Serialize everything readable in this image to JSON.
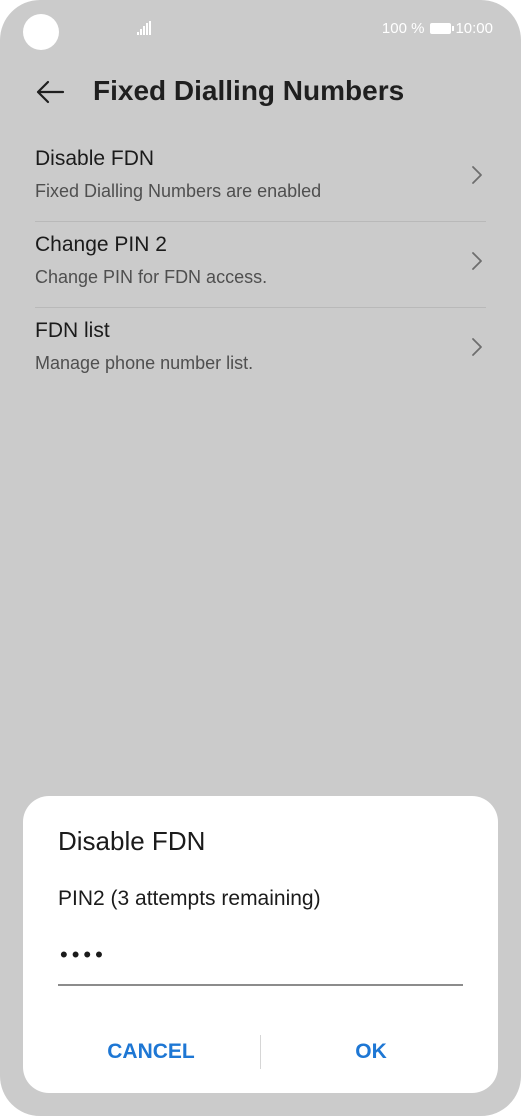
{
  "status_bar": {
    "battery_text": "100 %",
    "time": "10:00"
  },
  "header": {
    "back_icon": "arrow-left-icon",
    "title": "Fixed Dialling Numbers"
  },
  "list": {
    "items": [
      {
        "title": "Disable FDN",
        "subtitle": "Fixed Dialling Numbers are enabled"
      },
      {
        "title": "Change PIN 2",
        "subtitle": "Change PIN for FDN access."
      },
      {
        "title": "FDN list",
        "subtitle": "Manage phone number list."
      }
    ],
    "chevron_icon": "chevron-right-icon"
  },
  "dialog": {
    "title": "Disable FDN",
    "label": "PIN2 (3 attempts remaining)",
    "pin_value": "••••",
    "cancel_label": "CANCEL",
    "ok_label": "OK"
  },
  "colors": {
    "background": "#cbcbcb",
    "accent": "#1e77d4",
    "dialog_background": "#ffffff"
  }
}
